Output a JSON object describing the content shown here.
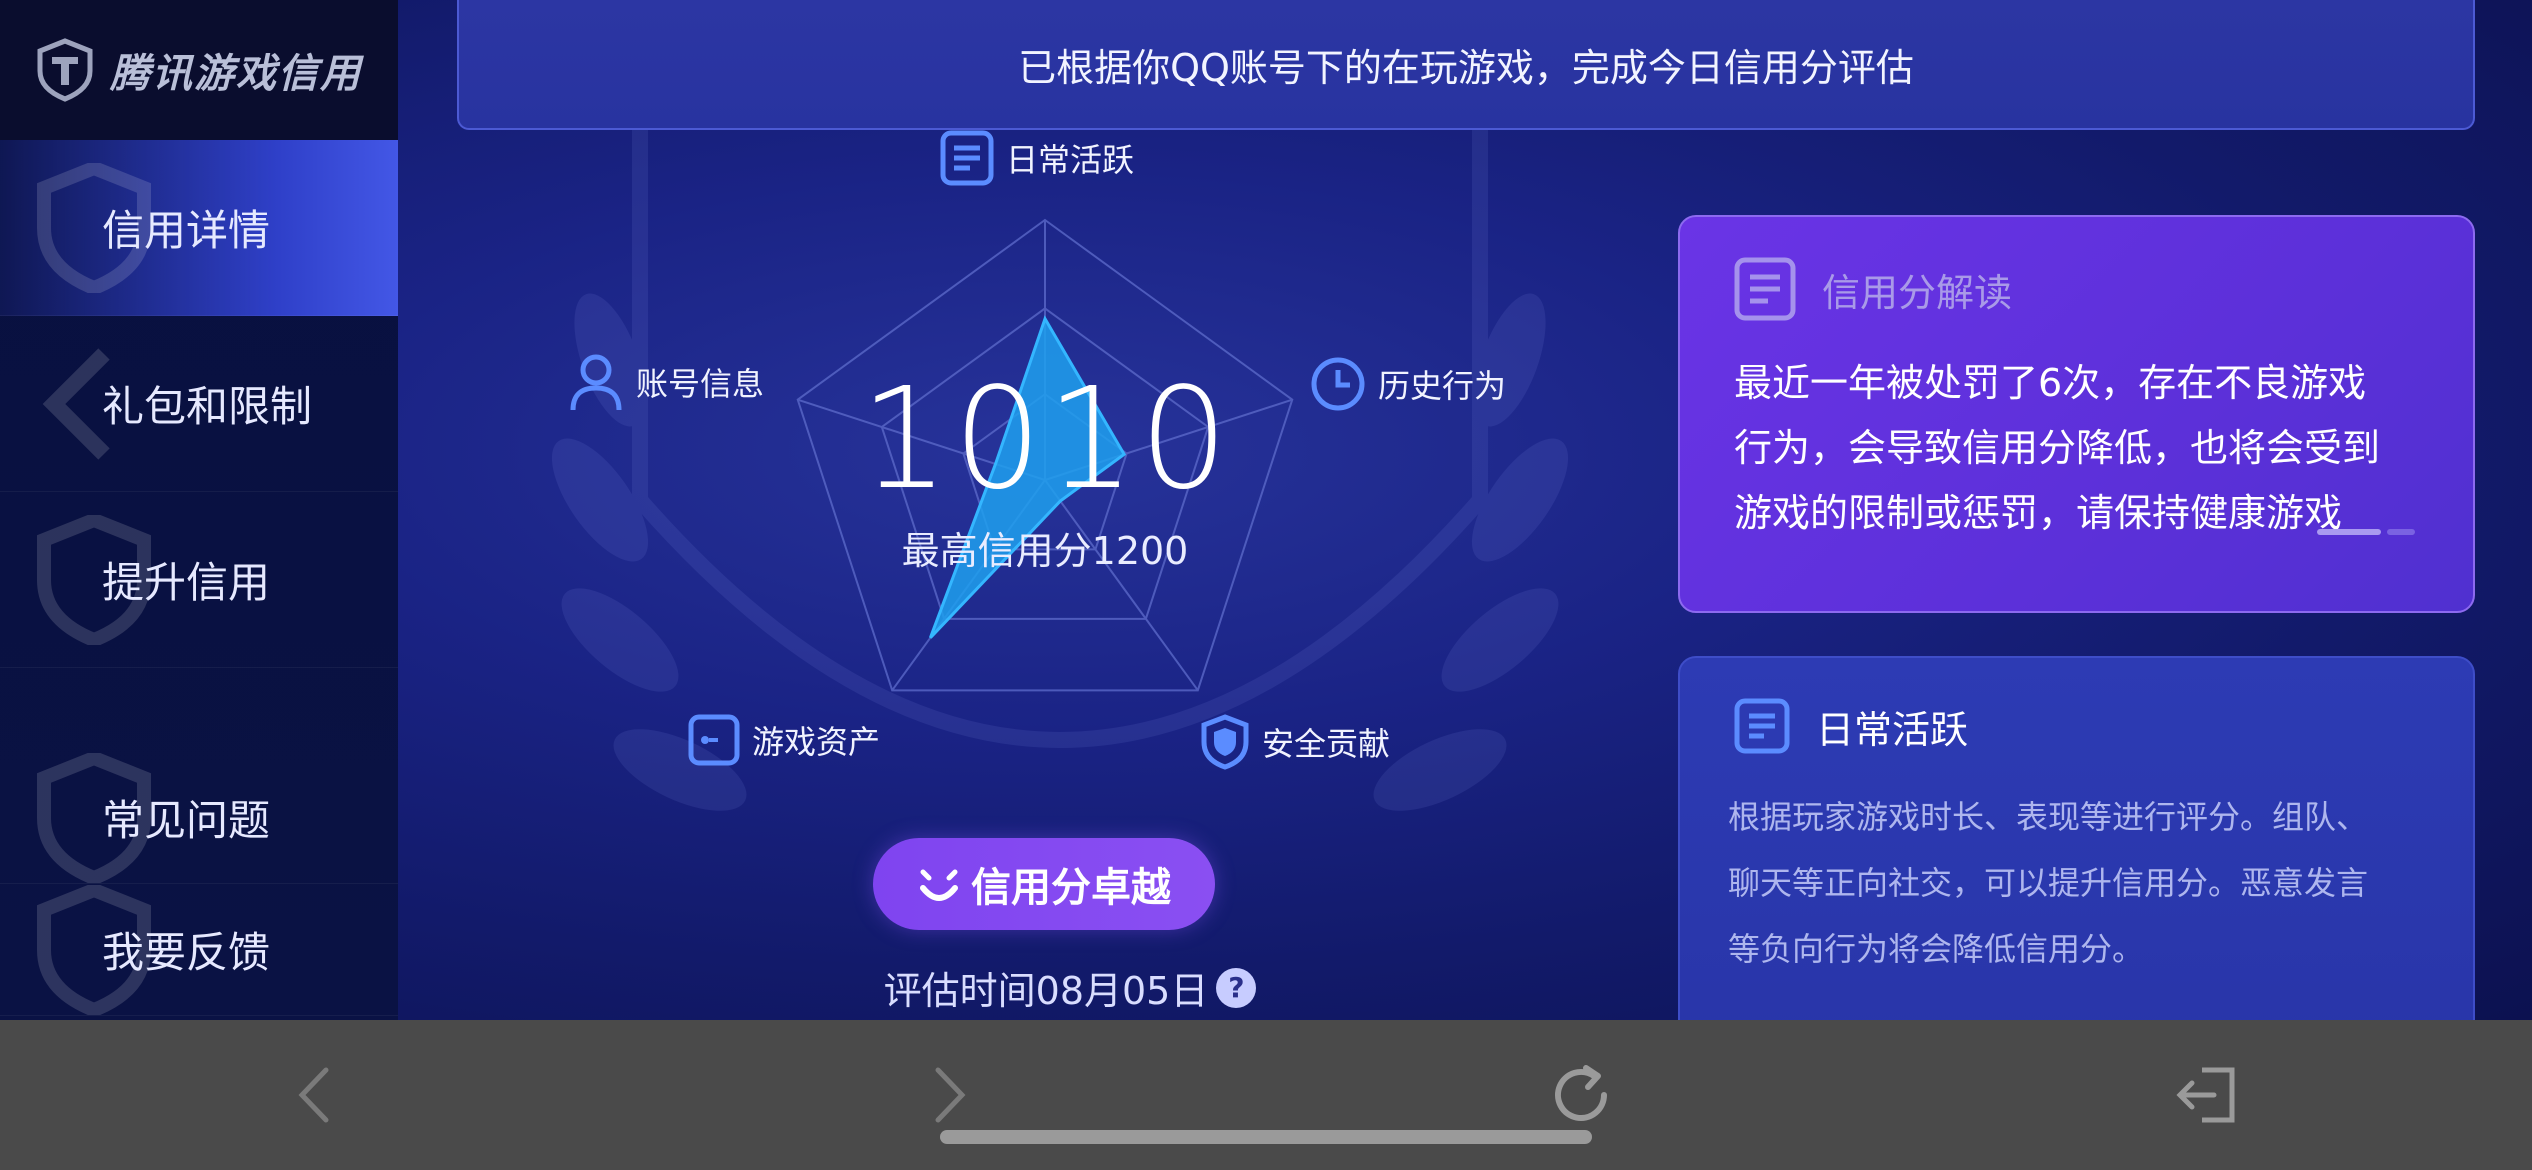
{
  "brand": {
    "title": "腾讯游戏信用"
  },
  "sidebar": {
    "items": [
      {
        "label": "信用详情",
        "active": true
      },
      {
        "label": "礼包和限制",
        "active": false
      },
      {
        "label": "提升信用",
        "active": false
      },
      {
        "label": "常见问题",
        "active": false
      },
      {
        "label": "我要反馈",
        "active": false
      }
    ]
  },
  "banner": {
    "text": "已根据你QQ账号下的在玩游戏，完成今日信用分评估"
  },
  "radar": {
    "axes": [
      {
        "label": "日常活跃",
        "icon": "document-icon"
      },
      {
        "label": "历史行为",
        "icon": "clock-icon"
      },
      {
        "label": "安全贡献",
        "icon": "shield-icon"
      },
      {
        "label": "游戏资产",
        "icon": "asset-icon"
      },
      {
        "label": "账号信息",
        "icon": "user-icon"
      }
    ],
    "values": [
      0.62,
      0.32,
      0.1,
      0.75,
      0.2
    ],
    "score": "1010",
    "max_score": "最高信用分1200"
  },
  "rating_button": {
    "label": "信用分卓越",
    "icon": "smile-icon"
  },
  "eval_time": {
    "text": "评估时间08月05日",
    "help": "?"
  },
  "interpret_card": {
    "title": "信用分解读",
    "lines": [
      "最近一年被处罚了6次，存在不良游戏",
      "行为，会导致信用分降低，也将会受到",
      "游戏的限制或惩罚，请保持健康游戏"
    ]
  },
  "daily_card": {
    "title": "日常活跃",
    "lines": [
      "根据玩家游戏时长、表现等进行评分。组队、",
      "聊天等正向社交，可以提升信用分。恶意发言",
      "等负向行为将会降低信用分。"
    ]
  },
  "colors": {
    "accent": "#7f44f0",
    "radar_fill": "#1fa0ee",
    "card_purple": "#6a34e6",
    "sidebar_active": "#3b4fe0"
  }
}
